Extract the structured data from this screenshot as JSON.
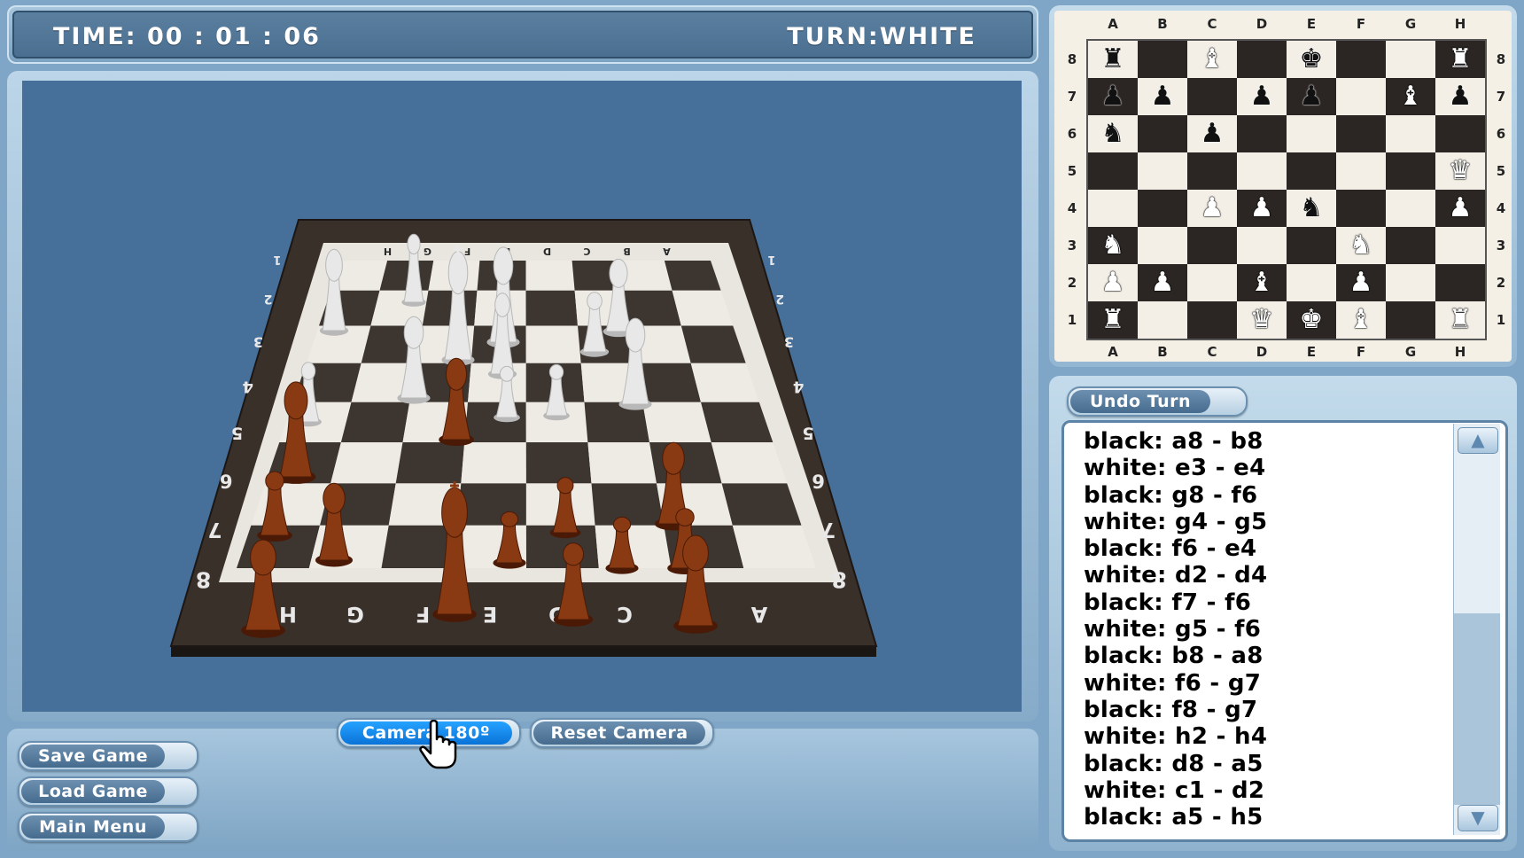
{
  "status": {
    "time_label": "TIME: 00 : 01 : 06",
    "turn_label": "TURN:WHITE"
  },
  "buttons": {
    "camera": "Camera 180º",
    "reset_camera": "Reset Camera",
    "save_game": "Save Game",
    "load_game": "Load Game",
    "main_menu": "Main Menu",
    "undo_turn": "Undo Turn"
  },
  "mini_board": {
    "files": [
      "A",
      "B",
      "C",
      "D",
      "E",
      "F",
      "G",
      "H"
    ],
    "ranks": [
      "8",
      "7",
      "6",
      "5",
      "4",
      "3",
      "2",
      "1"
    ],
    "pieces": [
      {
        "sq": "a8",
        "color": "black",
        "type": "rook-icon",
        "glyph": "♜"
      },
      {
        "sq": "c8",
        "color": "white",
        "type": "bishop-icon",
        "glyph": "♝"
      },
      {
        "sq": "e8",
        "color": "black",
        "type": "king-icon",
        "glyph": "♚"
      },
      {
        "sq": "h8",
        "color": "white",
        "type": "rook-icon",
        "glyph": "♜"
      },
      {
        "sq": "a7",
        "color": "black",
        "type": "pawn-icon",
        "glyph": "♟"
      },
      {
        "sq": "b7",
        "color": "black",
        "type": "pawn-icon",
        "glyph": "♟"
      },
      {
        "sq": "d7",
        "color": "black",
        "type": "pawn-icon",
        "glyph": "♟"
      },
      {
        "sq": "e7",
        "color": "black",
        "type": "pawn-icon",
        "glyph": "♟"
      },
      {
        "sq": "g7",
        "color": "white",
        "type": "bishop-icon",
        "glyph": "♝"
      },
      {
        "sq": "h7",
        "color": "black",
        "type": "pawn-icon",
        "glyph": "♟"
      },
      {
        "sq": "a6",
        "color": "black",
        "type": "knight-icon",
        "glyph": "♞"
      },
      {
        "sq": "c6",
        "color": "black",
        "type": "pawn-icon",
        "glyph": "♟"
      },
      {
        "sq": "h5",
        "color": "white",
        "type": "queen-icon",
        "glyph": "♛"
      },
      {
        "sq": "c4",
        "color": "white",
        "type": "pawn-icon",
        "glyph": "♟"
      },
      {
        "sq": "d4",
        "color": "white",
        "type": "pawn-icon",
        "glyph": "♟"
      },
      {
        "sq": "e4",
        "color": "black",
        "type": "knight-icon",
        "glyph": "♞"
      },
      {
        "sq": "h4",
        "color": "white",
        "type": "pawn-icon",
        "glyph": "♟"
      },
      {
        "sq": "a3",
        "color": "white",
        "type": "knight-icon",
        "glyph": "♞"
      },
      {
        "sq": "f3",
        "color": "white",
        "type": "knight-icon",
        "glyph": "♞"
      },
      {
        "sq": "a2",
        "color": "white",
        "type": "pawn-icon",
        "glyph": "♟"
      },
      {
        "sq": "b2",
        "color": "white",
        "type": "pawn-icon",
        "glyph": "♟"
      },
      {
        "sq": "d2",
        "color": "white",
        "type": "bishop-icon",
        "glyph": "♝"
      },
      {
        "sq": "f2",
        "color": "white",
        "type": "pawn-icon",
        "glyph": "♟"
      },
      {
        "sq": "a1",
        "color": "white",
        "type": "rook-icon",
        "glyph": "♜"
      },
      {
        "sq": "d1",
        "color": "white",
        "type": "queen-icon",
        "glyph": "♛"
      },
      {
        "sq": "e1",
        "color": "white",
        "type": "king-icon",
        "glyph": "♚"
      },
      {
        "sq": "f1",
        "color": "white",
        "type": "bishop-icon",
        "glyph": "♝"
      },
      {
        "sq": "h1",
        "color": "white",
        "type": "rook-icon",
        "glyph": "♜"
      }
    ]
  },
  "board3d": {
    "near_files": [
      "H",
      "G",
      "F",
      "E",
      "D",
      "C",
      "B",
      "A"
    ],
    "far_files": [
      "H",
      "G",
      "F",
      "E",
      "D",
      "C",
      "B",
      "A"
    ],
    "ranks": [
      "1",
      "2",
      "3",
      "4",
      "5",
      "6",
      "7",
      "8"
    ]
  },
  "moves": [
    "black: a8 - b8",
    "white: e3 - e4",
    "black: g8 - f6",
    "white: g4 - g5",
    "black: f6 - e4",
    "white: d2 - d4",
    "black: f7 - f6",
    "white: g5 - f6",
    "black: b8 - a8",
    "white: f6 - g7",
    "black: f8 - g7",
    "white: h2 - h4",
    "black: d8 - a5",
    "white: c1 - d2",
    "black: a5 - h5"
  ],
  "colors": {
    "viewport_bg": "#466f99",
    "active_button": "#1a8cf0"
  }
}
